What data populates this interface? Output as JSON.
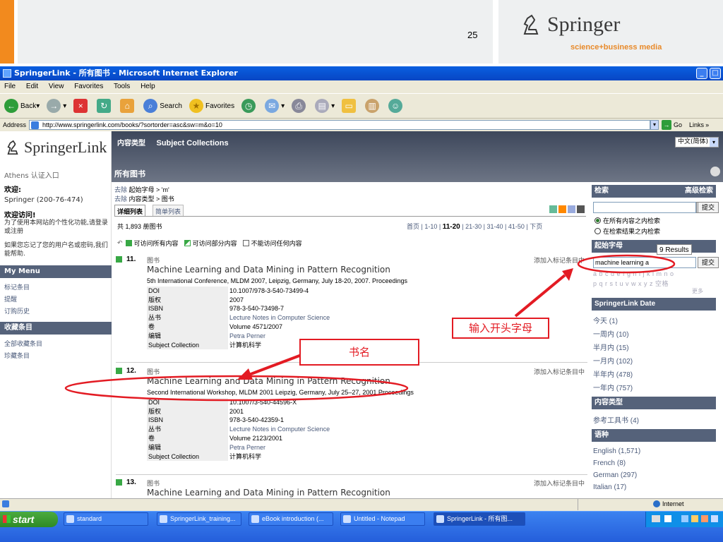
{
  "slide": {
    "page_number": "25",
    "logo_text": "Springer",
    "logo_tagline": "science+business media"
  },
  "window": {
    "title": "SpringerLink - 所有图书 - Microsoft Internet Explorer"
  },
  "menu": [
    "File",
    "Edit",
    "View",
    "Favorites",
    "Tools",
    "Help"
  ],
  "toolbar": {
    "back": "Back",
    "search": "Search",
    "favorites": "Favorites"
  },
  "address": {
    "label": "Address",
    "url": "http://www.springerlink.com/books/?sortorder=asc&sw=m&o=10",
    "go": "Go",
    "links": "Links"
  },
  "site": {
    "brand": "SpringerLink",
    "nav_content_type": "内容类型",
    "nav_subject_collections": "Subject Collections",
    "language": "中文(简体)",
    "page_heading": "所有图书"
  },
  "left": {
    "athens": "Athens 认证入口",
    "welcome_label": "欢迎:",
    "account": "Springer (200-76-474)",
    "visit_label": "欢迎访问!",
    "personalize": "为了使用本网站的个性化功能,请登录或注册",
    "forgot": "如果您忘记了您的用户名或密码,我们能帮助.",
    "mymenu": "My Menu",
    "mymenu_items": [
      "标记条目",
      "提醒",
      "订购历史"
    ],
    "favorites_head": "收藏条目",
    "favorites_items": [
      "全部收藏条目",
      "珍藏条目"
    ]
  },
  "filters": {
    "line1_remove": "去除",
    "line1_text": "起始字母 > 'm'",
    "line2_remove": "去除",
    "line2_text": "内容类型 > 图书"
  },
  "views": {
    "detail": "详细列表",
    "simple": "简单列表"
  },
  "results": {
    "count": "共 1,893 册图书",
    "pager": [
      "首页",
      "1-10",
      "11-20",
      "21-30",
      "31-40",
      "41-50",
      "下页"
    ],
    "legend_full": "可访问所有内容",
    "legend_partial": "可访问部分内容",
    "legend_none": "不能访问任何内容"
  },
  "entries": [
    {
      "num": "11.",
      "type": "图书",
      "add": "添加入标记条目中",
      "title": "Machine Learning and Data Mining in Pattern Recognition",
      "subtitle": "5th International Conference, MLDM 2007, Leipzig, Germany, July 18-20, 2007. Proceedings",
      "rows": [
        {
          "k": "DOI",
          "v": "10.1007/978-3-540-73499-4"
        },
        {
          "k": "版权",
          "v": "2007"
        },
        {
          "k": "ISBN",
          "v": "978-3-540-73498-7"
        },
        {
          "k": "丛书",
          "v": "Lecture Notes in Computer Science"
        },
        {
          "k": "卷",
          "v": "Volume 4571/2007"
        },
        {
          "k": "编辑",
          "v": "Petra Perner"
        },
        {
          "k": "Subject Collection",
          "v": "计算机科学"
        }
      ]
    },
    {
      "num": "12.",
      "type": "图书",
      "add": "添加入标记条目中",
      "title": "Machine Learning and Data Mining in Pattern Recognition",
      "subtitle": "Second International Workshop, MLDM 2001 Leipzig, Germany, July 25–27, 2001 Proceedings",
      "rows": [
        {
          "k": "DOI",
          "v": "10.1007/3-540-44596-X"
        },
        {
          "k": "版权",
          "v": "2001"
        },
        {
          "k": "ISBN",
          "v": "978-3-540-42359-1"
        },
        {
          "k": "丛书",
          "v": "Lecture Notes in Computer Science"
        },
        {
          "k": "卷",
          "v": "Volume 2123/2001"
        },
        {
          "k": "编辑",
          "v": "Petra Perner"
        },
        {
          "k": "Subject Collection",
          "v": "计算机科学"
        }
      ]
    },
    {
      "num": "13.",
      "type": "图书",
      "add": "添加入标记条目中",
      "title": "Machine Learning and Data Mining in Pattern Recognition"
    }
  ],
  "right": {
    "search_head": "检索",
    "advanced": "高级检索",
    "submit": "提交",
    "ellipsis": "...",
    "scope_all": "在所有内容之内检索",
    "scope_results": "在检索结果之内检索",
    "start_letter_head": "起始字母",
    "tooltip": "9 Results",
    "letter_input": "machine learning a",
    "letters_row1": "a b c d e f g h i j k l m n o",
    "letters_row2": "p q r s t u v w x y z 空格",
    "more": "更多",
    "date_head": "SpringerLink Date",
    "dates": [
      "今天 (1)",
      "一周内 (10)",
      "半月内 (15)",
      "一月内 (102)",
      "半年内 (478)",
      "一年内 (757)"
    ],
    "ctype_head": "内容类型",
    "ctype_items": [
      "参考工具书 (4)"
    ],
    "lang_head": "语种",
    "languages": [
      "English (1,571)",
      "French (8)",
      "German (297)",
      "Italian (17)"
    ]
  },
  "annotations": {
    "book_title": "书名",
    "enter_letters": "输入开头字母"
  },
  "status": {
    "zone": "Internet"
  },
  "taskbar": {
    "start": "start",
    "tasks": [
      "standard",
      "SpringerLink_training...",
      "eBook introduction (...",
      "Untitled - Notepad",
      "SpringerLink - 所有图..."
    ]
  }
}
